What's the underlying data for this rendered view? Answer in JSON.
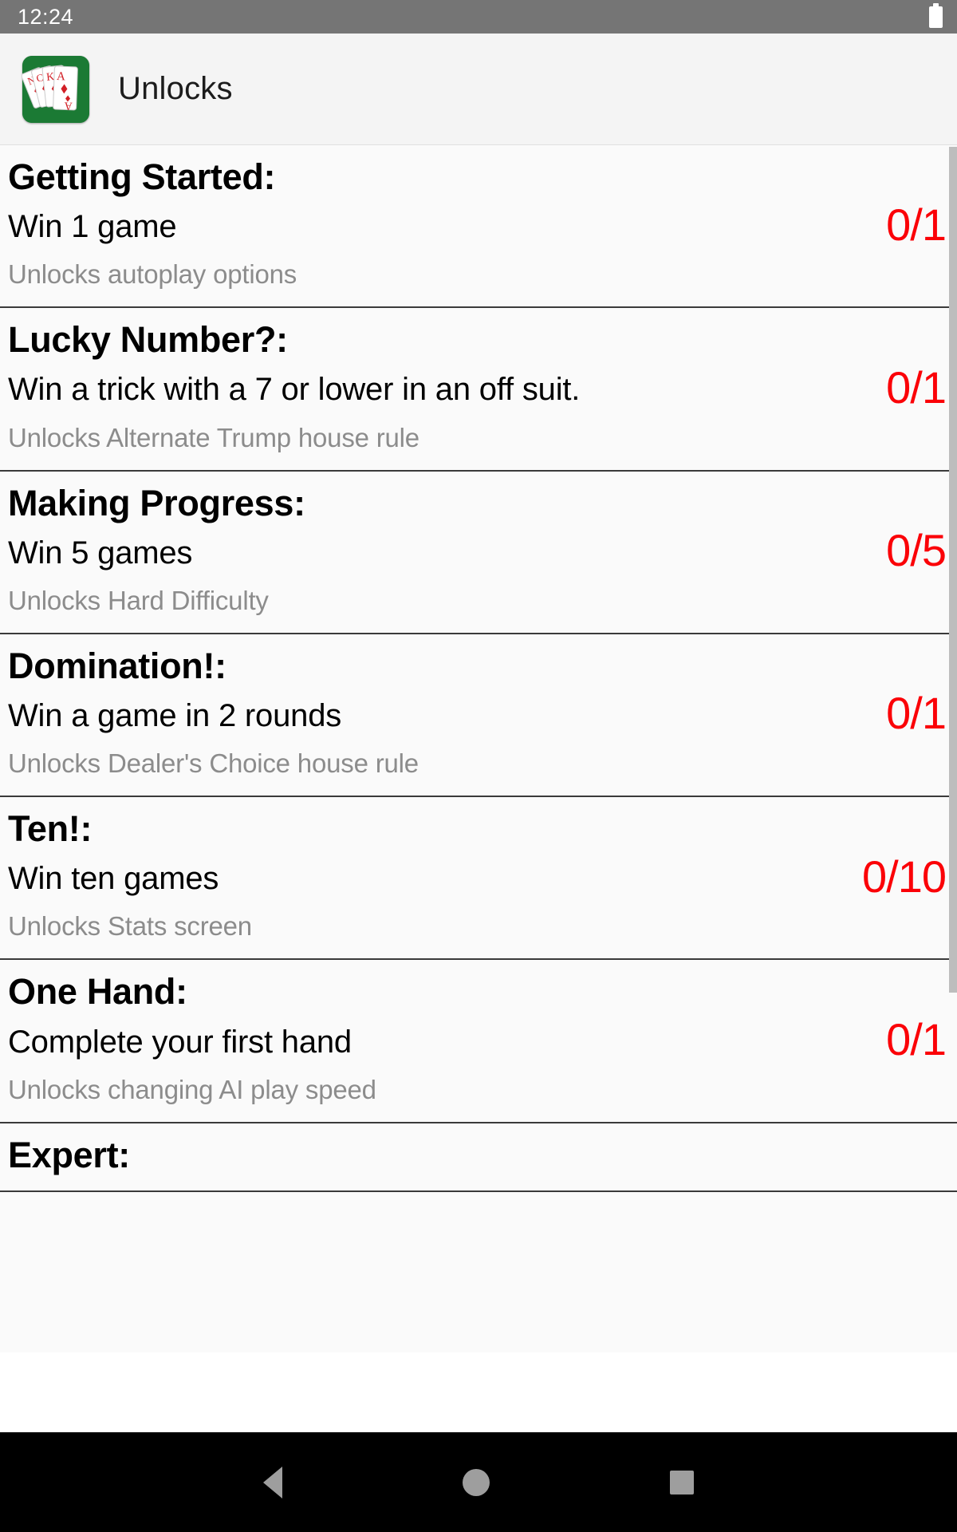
{
  "status_bar": {
    "time": "12:24",
    "battery_icon": "battery-icon"
  },
  "app_bar": {
    "title": "Unlocks",
    "icon": "card-deck-icon"
  },
  "colors": {
    "counter_red": "#fb0007",
    "icon_green": "#1b7a34",
    "subtext_gray": "#8c8c8c",
    "status_bar_gray": "#757575"
  },
  "achievements": [
    {
      "title": "Getting Started:",
      "description": "Win 1 game",
      "reward": "Unlocks autoplay options",
      "count": "0/1"
    },
    {
      "title": "Lucky Number?:",
      "description": "Win a trick with a 7 or lower in an off suit.",
      "reward": "Unlocks Alternate Trump house rule",
      "count": "0/1"
    },
    {
      "title": "Making Progress:",
      "description": "Win 5 games",
      "reward": "Unlocks Hard Difficulty",
      "count": "0/5"
    },
    {
      "title": "Domination!:",
      "description": "Win a game in 2 rounds",
      "reward": "Unlocks Dealer's Choice house rule",
      "count": "0/1"
    },
    {
      "title": "Ten!:",
      "description": "Win ten games",
      "reward": "Unlocks Stats screen",
      "count": "0/10"
    },
    {
      "title": "One Hand:",
      "description": "Complete your first hand",
      "reward": "Unlocks changing AI play speed",
      "count": "0/1"
    },
    {
      "title": "Expert:",
      "description": "",
      "reward": "",
      "count": ""
    }
  ],
  "nav_bar": {
    "back": "back-icon",
    "home": "home-icon",
    "recents": "recents-icon"
  }
}
